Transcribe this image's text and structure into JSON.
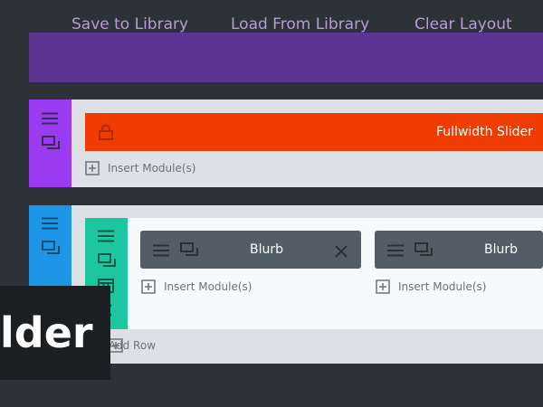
{
  "toolbar": {
    "save_label": "Save to Library",
    "load_label": "Load From Library",
    "clear_label": "Clear Layout"
  },
  "section1": {
    "module": {
      "label": "Fullwidth Slider",
      "icon": "lock-icon"
    },
    "insert_label": "Insert Module(s)"
  },
  "section2": {
    "row": {
      "columns": [
        {
          "module_label": "Blurb",
          "insert_label": "Insert Module(s)"
        },
        {
          "module_label": "Blurb",
          "insert_label": "Insert Module(s)"
        }
      ]
    },
    "add_row_label": "Add Row"
  },
  "overlay": {
    "text": "lder"
  },
  "colors": {
    "background": "#2d3138",
    "toolbar": "#5c3493",
    "section1_accent": "#9a3bf2",
    "section2_accent": "#1f95e8",
    "row_accent": "#1cc7a0",
    "fullwidth_module": "#ef3c00",
    "module": "#535d68"
  }
}
